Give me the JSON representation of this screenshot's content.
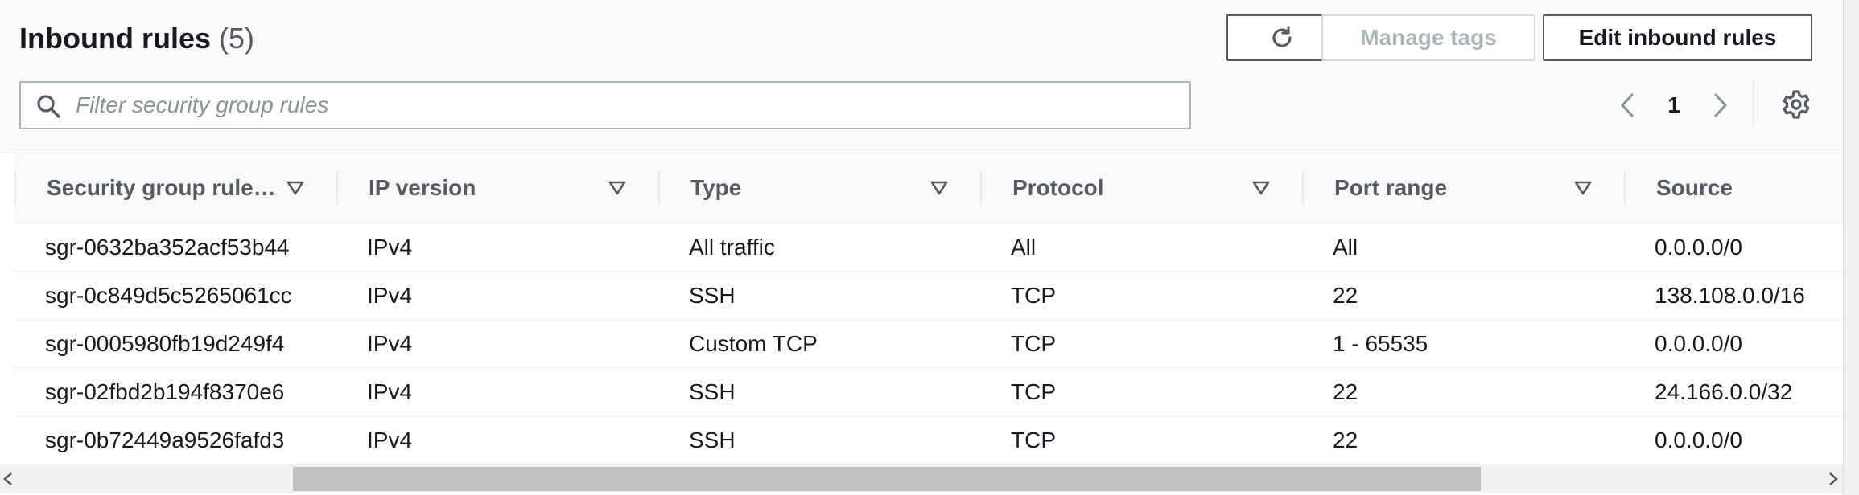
{
  "header": {
    "title": "Inbound rules",
    "count": "(5)",
    "buttons": {
      "refresh": "refresh-icon",
      "manage_tags": "Manage tags",
      "edit_inbound_rules": "Edit inbound rules"
    }
  },
  "filter": {
    "placeholder": "Filter security group rules",
    "value": ""
  },
  "pagination": {
    "current_page": "1"
  },
  "table": {
    "columns": [
      "Security group rule…",
      "IP version",
      "Type",
      "Protocol",
      "Port range",
      "Source"
    ],
    "rows": [
      [
        "sgr-0632ba352acf53b44",
        "IPv4",
        "All traffic",
        "All",
        "All",
        "0.0.0.0/0"
      ],
      [
        "sgr-0c849d5c5265061cc",
        "IPv4",
        "SSH",
        "TCP",
        "22",
        "138.108.0.0/16"
      ],
      [
        "sgr-0005980fb19d249f4",
        "IPv4",
        "Custom TCP",
        "TCP",
        "1 - 65535",
        "0.0.0.0/0"
      ],
      [
        "sgr-02fbd2b194f8370e6",
        "IPv4",
        "SSH",
        "TCP",
        "22",
        "24.166.0.0/32"
      ],
      [
        "sgr-0b72449a9526fafd3",
        "IPv4",
        "SSH",
        "TCP",
        "22",
        "0.0.0.0/0"
      ]
    ]
  },
  "colors": {
    "text": "#16191f",
    "muted_text": "#545b64",
    "disabled_text": "#aab7b8",
    "header_bg": "#fafafa",
    "border": "#eaeded"
  }
}
